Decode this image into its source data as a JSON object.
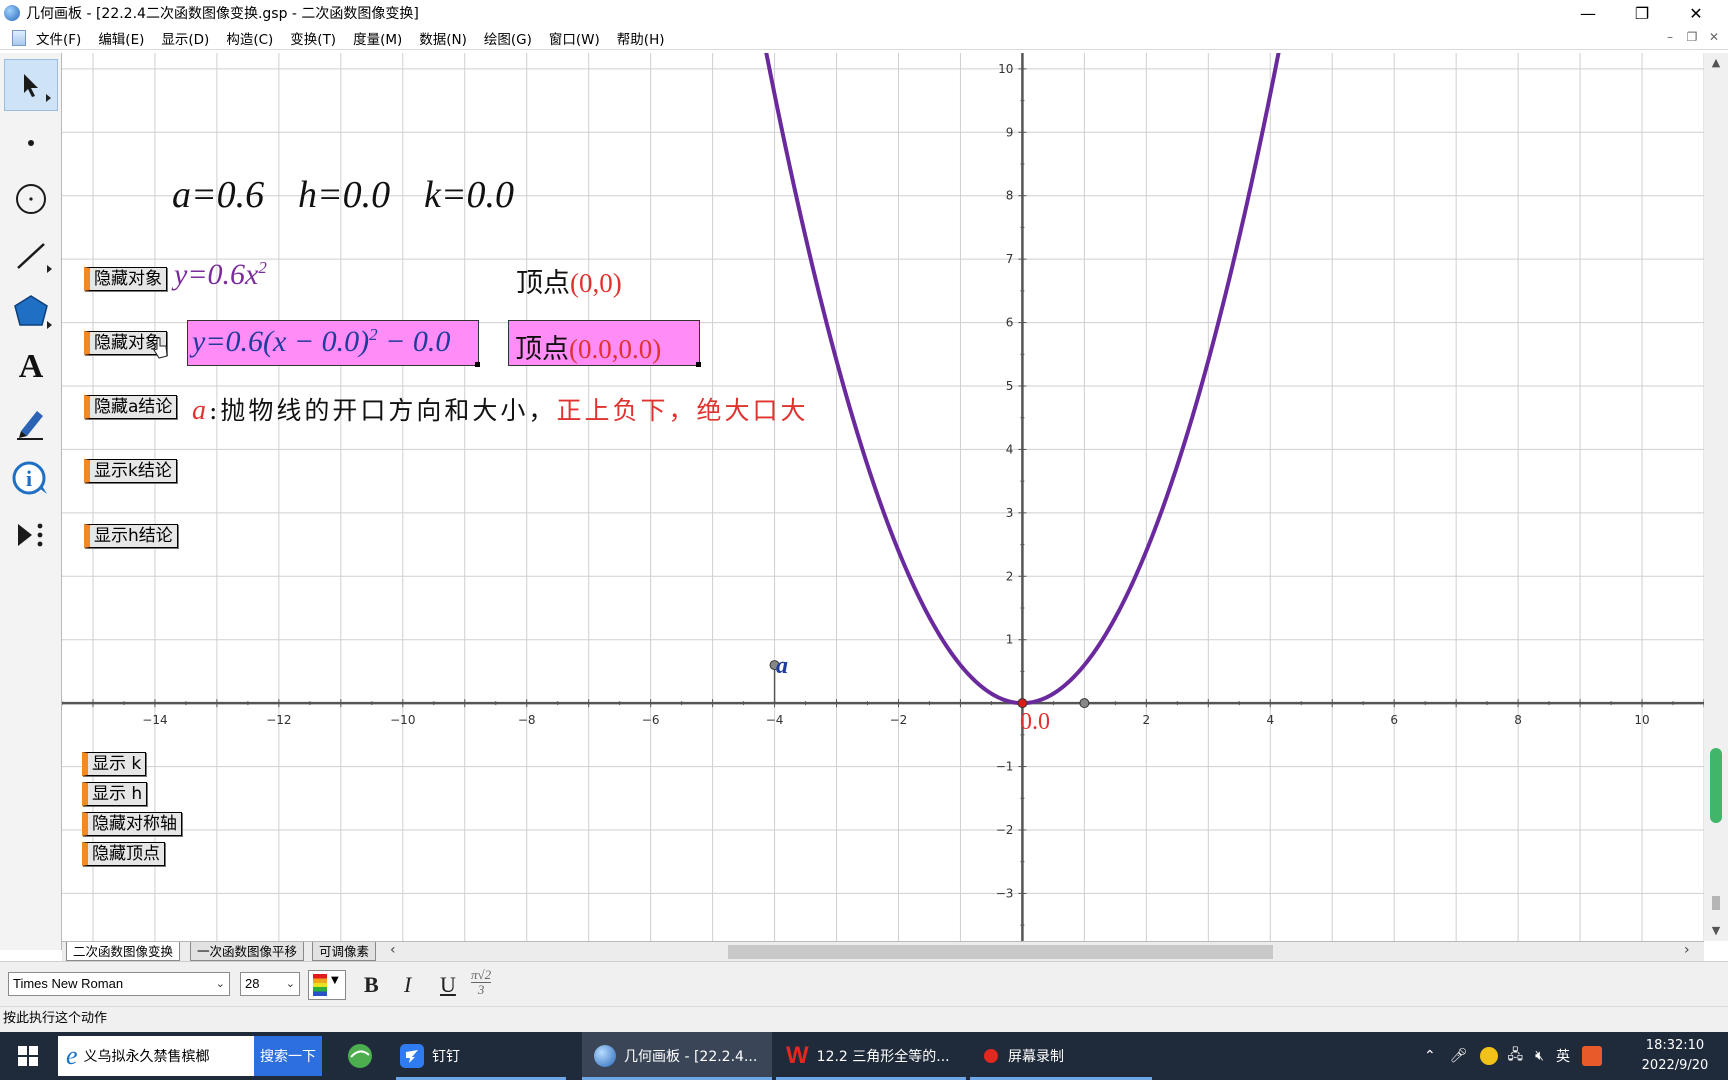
{
  "window": {
    "title": "几何画板 - [22.2.4二次函数图像变换.gsp - 二次函数图像变换]",
    "controls": {
      "minimize": "—",
      "restore": "❐",
      "close": "✕"
    }
  },
  "menu": {
    "items": [
      "文件(F)",
      "编辑(E)",
      "显示(D)",
      "构造(C)",
      "变换(T)",
      "度量(M)",
      "数据(N)",
      "绘图(G)",
      "窗口(W)",
      "帮助(H)"
    ],
    "mdi_controls": [
      "–",
      "❐",
      "✕"
    ]
  },
  "tools": [
    {
      "name": "arrow-select-tool",
      "glyph": "➤"
    },
    {
      "name": "point-tool",
      "glyph": "•"
    },
    {
      "name": "compass-tool",
      "glyph": "⊙"
    },
    {
      "name": "straightedge-tool",
      "glyph": "╱"
    },
    {
      "name": "polygon-tool",
      "glyph": "⬟"
    },
    {
      "name": "text-tool",
      "glyph": "A"
    },
    {
      "name": "marker-tool",
      "glyph": "✎"
    },
    {
      "name": "information-tool",
      "glyph": "ⓘ"
    },
    {
      "name": "custom-tool",
      "glyph": "▶⋮"
    }
  ],
  "params": {
    "a": "a=0.6",
    "h": "h=0.0",
    "k": "k=0.0"
  },
  "buttons": {
    "hide_object_1": "隐藏对象",
    "hide_object_2": "隐藏对象",
    "hide_a_conclusion": "隐藏a结论",
    "show_k_conclusion": "显示k结论",
    "show_h_conclusion": "显示h结论",
    "show_k": "显示 k",
    "show_h": "显示 h",
    "hide_symmetry_axis": "隐藏对称轴",
    "hide_vertex": "隐藏顶点"
  },
  "equations": {
    "simple_prefix": "y=0.6x",
    "simple_exp": "2",
    "vertex1_label": "顶点",
    "vertex1_value": "(0,0)",
    "full_prefix": "y=0.6(x − 0.0)",
    "full_exp": "2",
    "full_suffix": " − 0.0",
    "vertex2_label": "顶点",
    "vertex2_value": "(0.0,0.0)"
  },
  "conclusion": {
    "var": "a",
    "text": ":抛物线的开口方向和大小，",
    "rule": "正上负下，绝大口大"
  },
  "graph_labels": {
    "slider_label": "a",
    "vertex_value": "0.0"
  },
  "chart_data": {
    "type": "line",
    "title": "",
    "xlabel": "",
    "ylabel": "",
    "xlim": [
      -15.5,
      11
    ],
    "ylim": [
      -3.75,
      10.25
    ],
    "x_ticks": [
      -14,
      -12,
      -10,
      -8,
      -6,
      -4,
      -2,
      2,
      4,
      6,
      8,
      10
    ],
    "y_ticks": [
      -3,
      -2,
      -1,
      1,
      2,
      3,
      4,
      5,
      6,
      7,
      8,
      9,
      10
    ],
    "grid": true,
    "series": [
      {
        "function": "y = 0.6x^2",
        "a": 0.6,
        "h": 0.0,
        "k": 0.0,
        "color": "#6a2a9e"
      }
    ],
    "points": [
      {
        "role": "vertex",
        "x": 0,
        "y": 0,
        "color": "#d81b1b"
      },
      {
        "role": "unit-point",
        "x": 1,
        "y": 0,
        "color": "#888888"
      },
      {
        "role": "slider-a",
        "x": -4,
        "y": 0.6,
        "color": "#888888"
      }
    ]
  },
  "tabs": [
    "二次函数图像变换",
    "一次函数图像平移",
    "可调像素"
  ],
  "textbar": {
    "font": "Times New Roman",
    "size": "28",
    "bold": "B",
    "italic": "I",
    "underline": "U",
    "math_top": "π√2",
    "math_bottom": "3"
  },
  "status": "按此执行这个动作",
  "taskbar": {
    "browser_item": "义乌拟永久禁售槟榔",
    "search_button": "搜索一下",
    "dingtalk": "钉钉",
    "gsp": "几何画板 - [22.2.4...",
    "wps": "12.2 三角形全等的...",
    "recorder": "屏幕录制",
    "ime": "英",
    "time": "18:32:10",
    "date": "2022/9/20"
  }
}
